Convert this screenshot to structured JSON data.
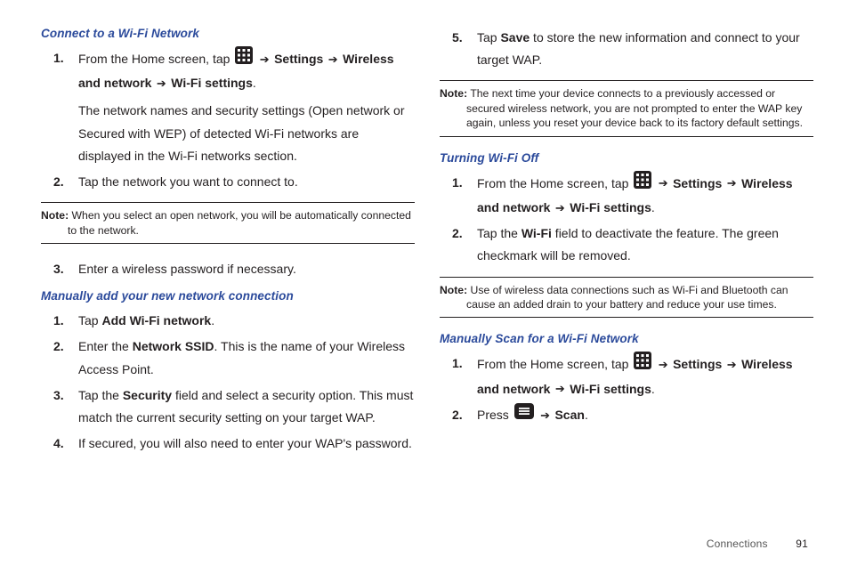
{
  "left": {
    "h1": "Connect to a Wi-Fi Network",
    "s1_a": "From the Home screen, tap ",
    "s1_b": " Settings ",
    "s1_c": " Wireless and network ",
    "s1_d": " Wi-Fi settings",
    "s1_e": ".",
    "s1_p": "The network names and security settings (Open network or Secured with WEP) of detected Wi-Fi networks are displayed in the Wi-Fi networks section.",
    "s2": "Tap the network you want to connect to.",
    "note1_label": "Note:",
    "note1_text": " When you select an open network, you will be automatically connected to the network.",
    "s3": "Enter a wireless password if necessary.",
    "h2": "Manually add your new network connection",
    "m1_a": " Tap ",
    "m1_b": "Add Wi-Fi network",
    "m1_c": ".",
    "m2_a": " Enter the ",
    "m2_b": "Network SSID",
    "m2_c": ". This is the name of your Wireless Access Point.",
    "m3_a": "Tap the ",
    "m3_b": "Security",
    "m3_c": " field and select a security option. This must match the current security setting on your target WAP.",
    "m4": " If secured, you will also need to enter your WAP's password."
  },
  "right": {
    "s5_a": "Tap ",
    "s5_b": "Save",
    "s5_c": " to store the new information and connect to your target WAP.",
    "note2_label": "Note:",
    "note2_text": " The next time your device connects to a previously accessed or secured wireless network, you are not prompted to enter the WAP key again, unless you reset your device back to its factory default settings.",
    "h3": "Turning Wi-Fi Off",
    "t1_a": "From the Home screen, tap ",
    "t1_b": " Settings ",
    "t1_c": " Wireless and network ",
    "t1_d": " Wi-Fi settings",
    "t1_e": ".",
    "t2_a": "Tap the ",
    "t2_b": "Wi-Fi",
    "t2_c": " field to deactivate the feature. The green checkmark will be removed.",
    "note3_label": "Note:",
    "note3_text": " Use of wireless data connections such as Wi-Fi and Bluetooth can cause an added drain to your battery and reduce your use times.",
    "h4": "Manually Scan for a Wi-Fi Network",
    "ms1_a": "From the Home screen, tap ",
    "ms1_b": " Settings ",
    "ms1_c": " Wireless and network ",
    "ms1_d": " Wi-Fi settings",
    "ms1_e": ".",
    "ms2_a": "Press ",
    "ms2_b": " Scan",
    "ms2_c": "."
  },
  "footer": {
    "section": "Connections",
    "page": "91"
  }
}
